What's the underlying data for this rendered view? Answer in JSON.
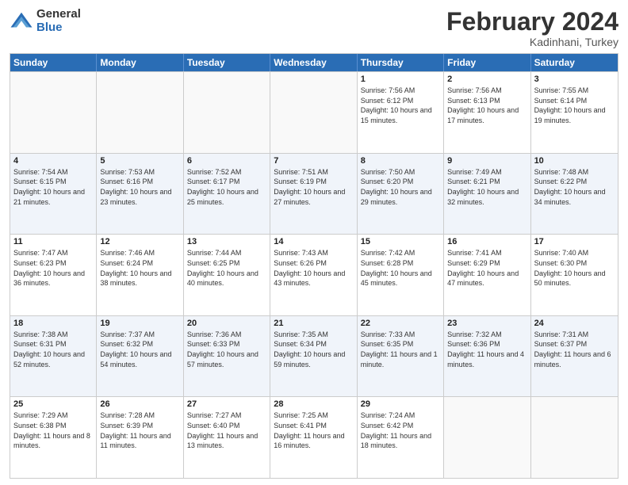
{
  "logo": {
    "general": "General",
    "blue": "Blue"
  },
  "header": {
    "title": "February 2024",
    "subtitle": "Kadinhani, Turkey"
  },
  "days_of_week": [
    "Sunday",
    "Monday",
    "Tuesday",
    "Wednesday",
    "Thursday",
    "Friday",
    "Saturday"
  ],
  "rows": [
    [
      {
        "day": "",
        "info": ""
      },
      {
        "day": "",
        "info": ""
      },
      {
        "day": "",
        "info": ""
      },
      {
        "day": "",
        "info": ""
      },
      {
        "day": "1",
        "info": "Sunrise: 7:56 AM\nSunset: 6:12 PM\nDaylight: 10 hours and 15 minutes."
      },
      {
        "day": "2",
        "info": "Sunrise: 7:56 AM\nSunset: 6:13 PM\nDaylight: 10 hours and 17 minutes."
      },
      {
        "day": "3",
        "info": "Sunrise: 7:55 AM\nSunset: 6:14 PM\nDaylight: 10 hours and 19 minutes."
      }
    ],
    [
      {
        "day": "4",
        "info": "Sunrise: 7:54 AM\nSunset: 6:15 PM\nDaylight: 10 hours and 21 minutes."
      },
      {
        "day": "5",
        "info": "Sunrise: 7:53 AM\nSunset: 6:16 PM\nDaylight: 10 hours and 23 minutes."
      },
      {
        "day": "6",
        "info": "Sunrise: 7:52 AM\nSunset: 6:17 PM\nDaylight: 10 hours and 25 minutes."
      },
      {
        "day": "7",
        "info": "Sunrise: 7:51 AM\nSunset: 6:19 PM\nDaylight: 10 hours and 27 minutes."
      },
      {
        "day": "8",
        "info": "Sunrise: 7:50 AM\nSunset: 6:20 PM\nDaylight: 10 hours and 29 minutes."
      },
      {
        "day": "9",
        "info": "Sunrise: 7:49 AM\nSunset: 6:21 PM\nDaylight: 10 hours and 32 minutes."
      },
      {
        "day": "10",
        "info": "Sunrise: 7:48 AM\nSunset: 6:22 PM\nDaylight: 10 hours and 34 minutes."
      }
    ],
    [
      {
        "day": "11",
        "info": "Sunrise: 7:47 AM\nSunset: 6:23 PM\nDaylight: 10 hours and 36 minutes."
      },
      {
        "day": "12",
        "info": "Sunrise: 7:46 AM\nSunset: 6:24 PM\nDaylight: 10 hours and 38 minutes."
      },
      {
        "day": "13",
        "info": "Sunrise: 7:44 AM\nSunset: 6:25 PM\nDaylight: 10 hours and 40 minutes."
      },
      {
        "day": "14",
        "info": "Sunrise: 7:43 AM\nSunset: 6:26 PM\nDaylight: 10 hours and 43 minutes."
      },
      {
        "day": "15",
        "info": "Sunrise: 7:42 AM\nSunset: 6:28 PM\nDaylight: 10 hours and 45 minutes."
      },
      {
        "day": "16",
        "info": "Sunrise: 7:41 AM\nSunset: 6:29 PM\nDaylight: 10 hours and 47 minutes."
      },
      {
        "day": "17",
        "info": "Sunrise: 7:40 AM\nSunset: 6:30 PM\nDaylight: 10 hours and 50 minutes."
      }
    ],
    [
      {
        "day": "18",
        "info": "Sunrise: 7:38 AM\nSunset: 6:31 PM\nDaylight: 10 hours and 52 minutes."
      },
      {
        "day": "19",
        "info": "Sunrise: 7:37 AM\nSunset: 6:32 PM\nDaylight: 10 hours and 54 minutes."
      },
      {
        "day": "20",
        "info": "Sunrise: 7:36 AM\nSunset: 6:33 PM\nDaylight: 10 hours and 57 minutes."
      },
      {
        "day": "21",
        "info": "Sunrise: 7:35 AM\nSunset: 6:34 PM\nDaylight: 10 hours and 59 minutes."
      },
      {
        "day": "22",
        "info": "Sunrise: 7:33 AM\nSunset: 6:35 PM\nDaylight: 11 hours and 1 minute."
      },
      {
        "day": "23",
        "info": "Sunrise: 7:32 AM\nSunset: 6:36 PM\nDaylight: 11 hours and 4 minutes."
      },
      {
        "day": "24",
        "info": "Sunrise: 7:31 AM\nSunset: 6:37 PM\nDaylight: 11 hours and 6 minutes."
      }
    ],
    [
      {
        "day": "25",
        "info": "Sunrise: 7:29 AM\nSunset: 6:38 PM\nDaylight: 11 hours and 8 minutes."
      },
      {
        "day": "26",
        "info": "Sunrise: 7:28 AM\nSunset: 6:39 PM\nDaylight: 11 hours and 11 minutes."
      },
      {
        "day": "27",
        "info": "Sunrise: 7:27 AM\nSunset: 6:40 PM\nDaylight: 11 hours and 13 minutes."
      },
      {
        "day": "28",
        "info": "Sunrise: 7:25 AM\nSunset: 6:41 PM\nDaylight: 11 hours and 16 minutes."
      },
      {
        "day": "29",
        "info": "Sunrise: 7:24 AM\nSunset: 6:42 PM\nDaylight: 11 hours and 18 minutes."
      },
      {
        "day": "",
        "info": ""
      },
      {
        "day": "",
        "info": ""
      }
    ]
  ]
}
